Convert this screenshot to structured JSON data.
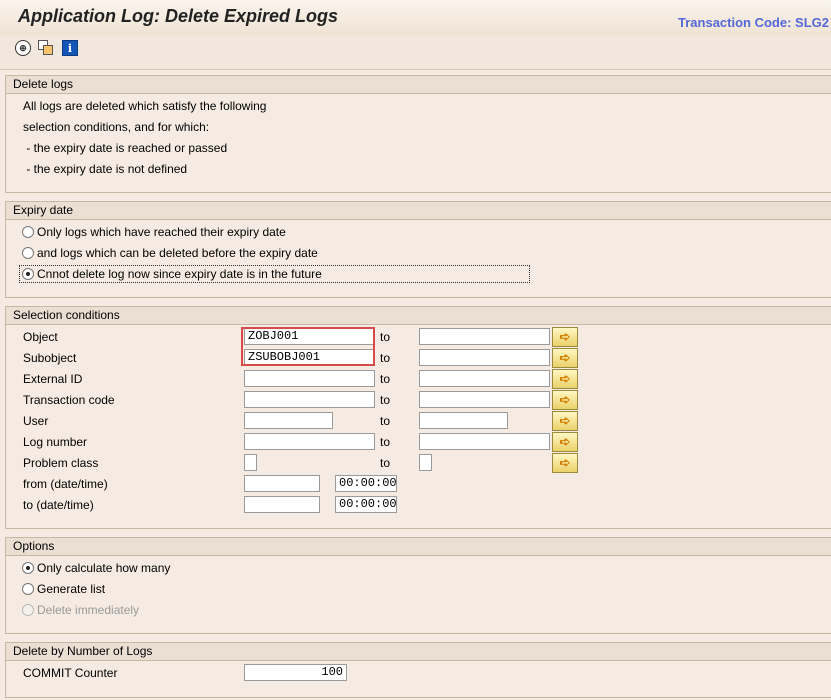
{
  "title": "Application Log: Delete Expired Logs",
  "transaction_code": "Transaction Code: SLG2",
  "toolbar": {
    "icons": [
      "clock-execute-icon",
      "multiple-selection-icon",
      "info-icon"
    ]
  },
  "delete_logs": {
    "header": "Delete logs",
    "lines": [
      "All logs are deleted which satisfy the following",
      "selection conditions, and for which:",
      " - the expiry date is reached or passed",
      " - the expiry date is not defined"
    ]
  },
  "expiry_date": {
    "header": "Expiry date",
    "options": [
      {
        "label": "Only logs which have reached their expiry date",
        "selected": false
      },
      {
        "label": "and logs which can be deleted before the expiry date",
        "selected": false
      },
      {
        "label": "Cnnot delete log now since expiry date is in the future",
        "selected": true
      }
    ]
  },
  "selection": {
    "header": "Selection conditions",
    "to_label": "to",
    "rows": [
      {
        "label": "Object",
        "from": "ZOBJ001",
        "to": ""
      },
      {
        "label": "Subobject",
        "from": "ZSUBOBJ001",
        "to": ""
      },
      {
        "label": "External ID",
        "from": "",
        "to": ""
      },
      {
        "label": "Transaction code",
        "from": "",
        "to": ""
      },
      {
        "label": "User",
        "from": "",
        "to": ""
      },
      {
        "label": "Log number",
        "from": "",
        "to": ""
      },
      {
        "label": "Problem class",
        "from": "",
        "to": ""
      }
    ],
    "from_datetime": {
      "label": "from (date/time)",
      "date": "",
      "time": "00:00:00"
    },
    "to_datetime": {
      "label": "to (date/time)",
      "date": "",
      "time": "00:00:00"
    }
  },
  "options": {
    "header": "Options",
    "items": [
      {
        "label": "Only calculate how many",
        "selected": true,
        "disabled": false
      },
      {
        "label": "Generate list",
        "selected": false,
        "disabled": false
      },
      {
        "label": "Delete immediately",
        "selected": false,
        "disabled": true
      }
    ]
  },
  "delete_by_number": {
    "header": "Delete by Number of Logs",
    "label": "COMMIT Counter",
    "value": "100"
  },
  "colors": {
    "background": "#f5ebe2",
    "group_header": "#ebdfd4",
    "transaction_code": "#5468d8",
    "highlight_box": "#d84a4a"
  }
}
